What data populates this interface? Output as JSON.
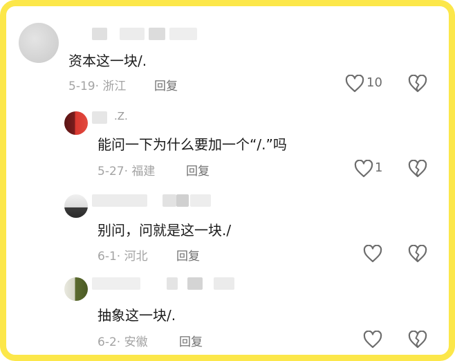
{
  "comments": [
    {
      "user": "",
      "text": "资本这一块/.",
      "date": "5-19",
      "location": "浙江",
      "reply_label": "回复",
      "likes": "10",
      "like_icon": "heart-outline-icon",
      "dislike_icon": "broken-heart-icon"
    },
    {
      "user": ".Z.",
      "text": "能问一下为什么要加一个“/.”吗",
      "date": "5-27",
      "location": "福建",
      "reply_label": "回复",
      "likes": "1",
      "like_icon": "heart-outline-icon",
      "dislike_icon": "broken-heart-icon"
    },
    {
      "user": "",
      "text": "别问，问就是这一块./",
      "date": "6-1",
      "location": "河北",
      "reply_label": "回复",
      "likes": "",
      "like_icon": "heart-outline-icon",
      "dislike_icon": "broken-heart-icon"
    },
    {
      "user": "",
      "text": "抽象这一块/.",
      "date": "6-2",
      "location": "安徽",
      "reply_label": "回复",
      "likes": "",
      "like_icon": "heart-outline-icon",
      "dislike_icon": "broken-heart-icon"
    }
  ],
  "colors": {
    "frame": "#fce74a",
    "meta_text": "#a3a3a3",
    "body_text": "#1a1a1a"
  }
}
